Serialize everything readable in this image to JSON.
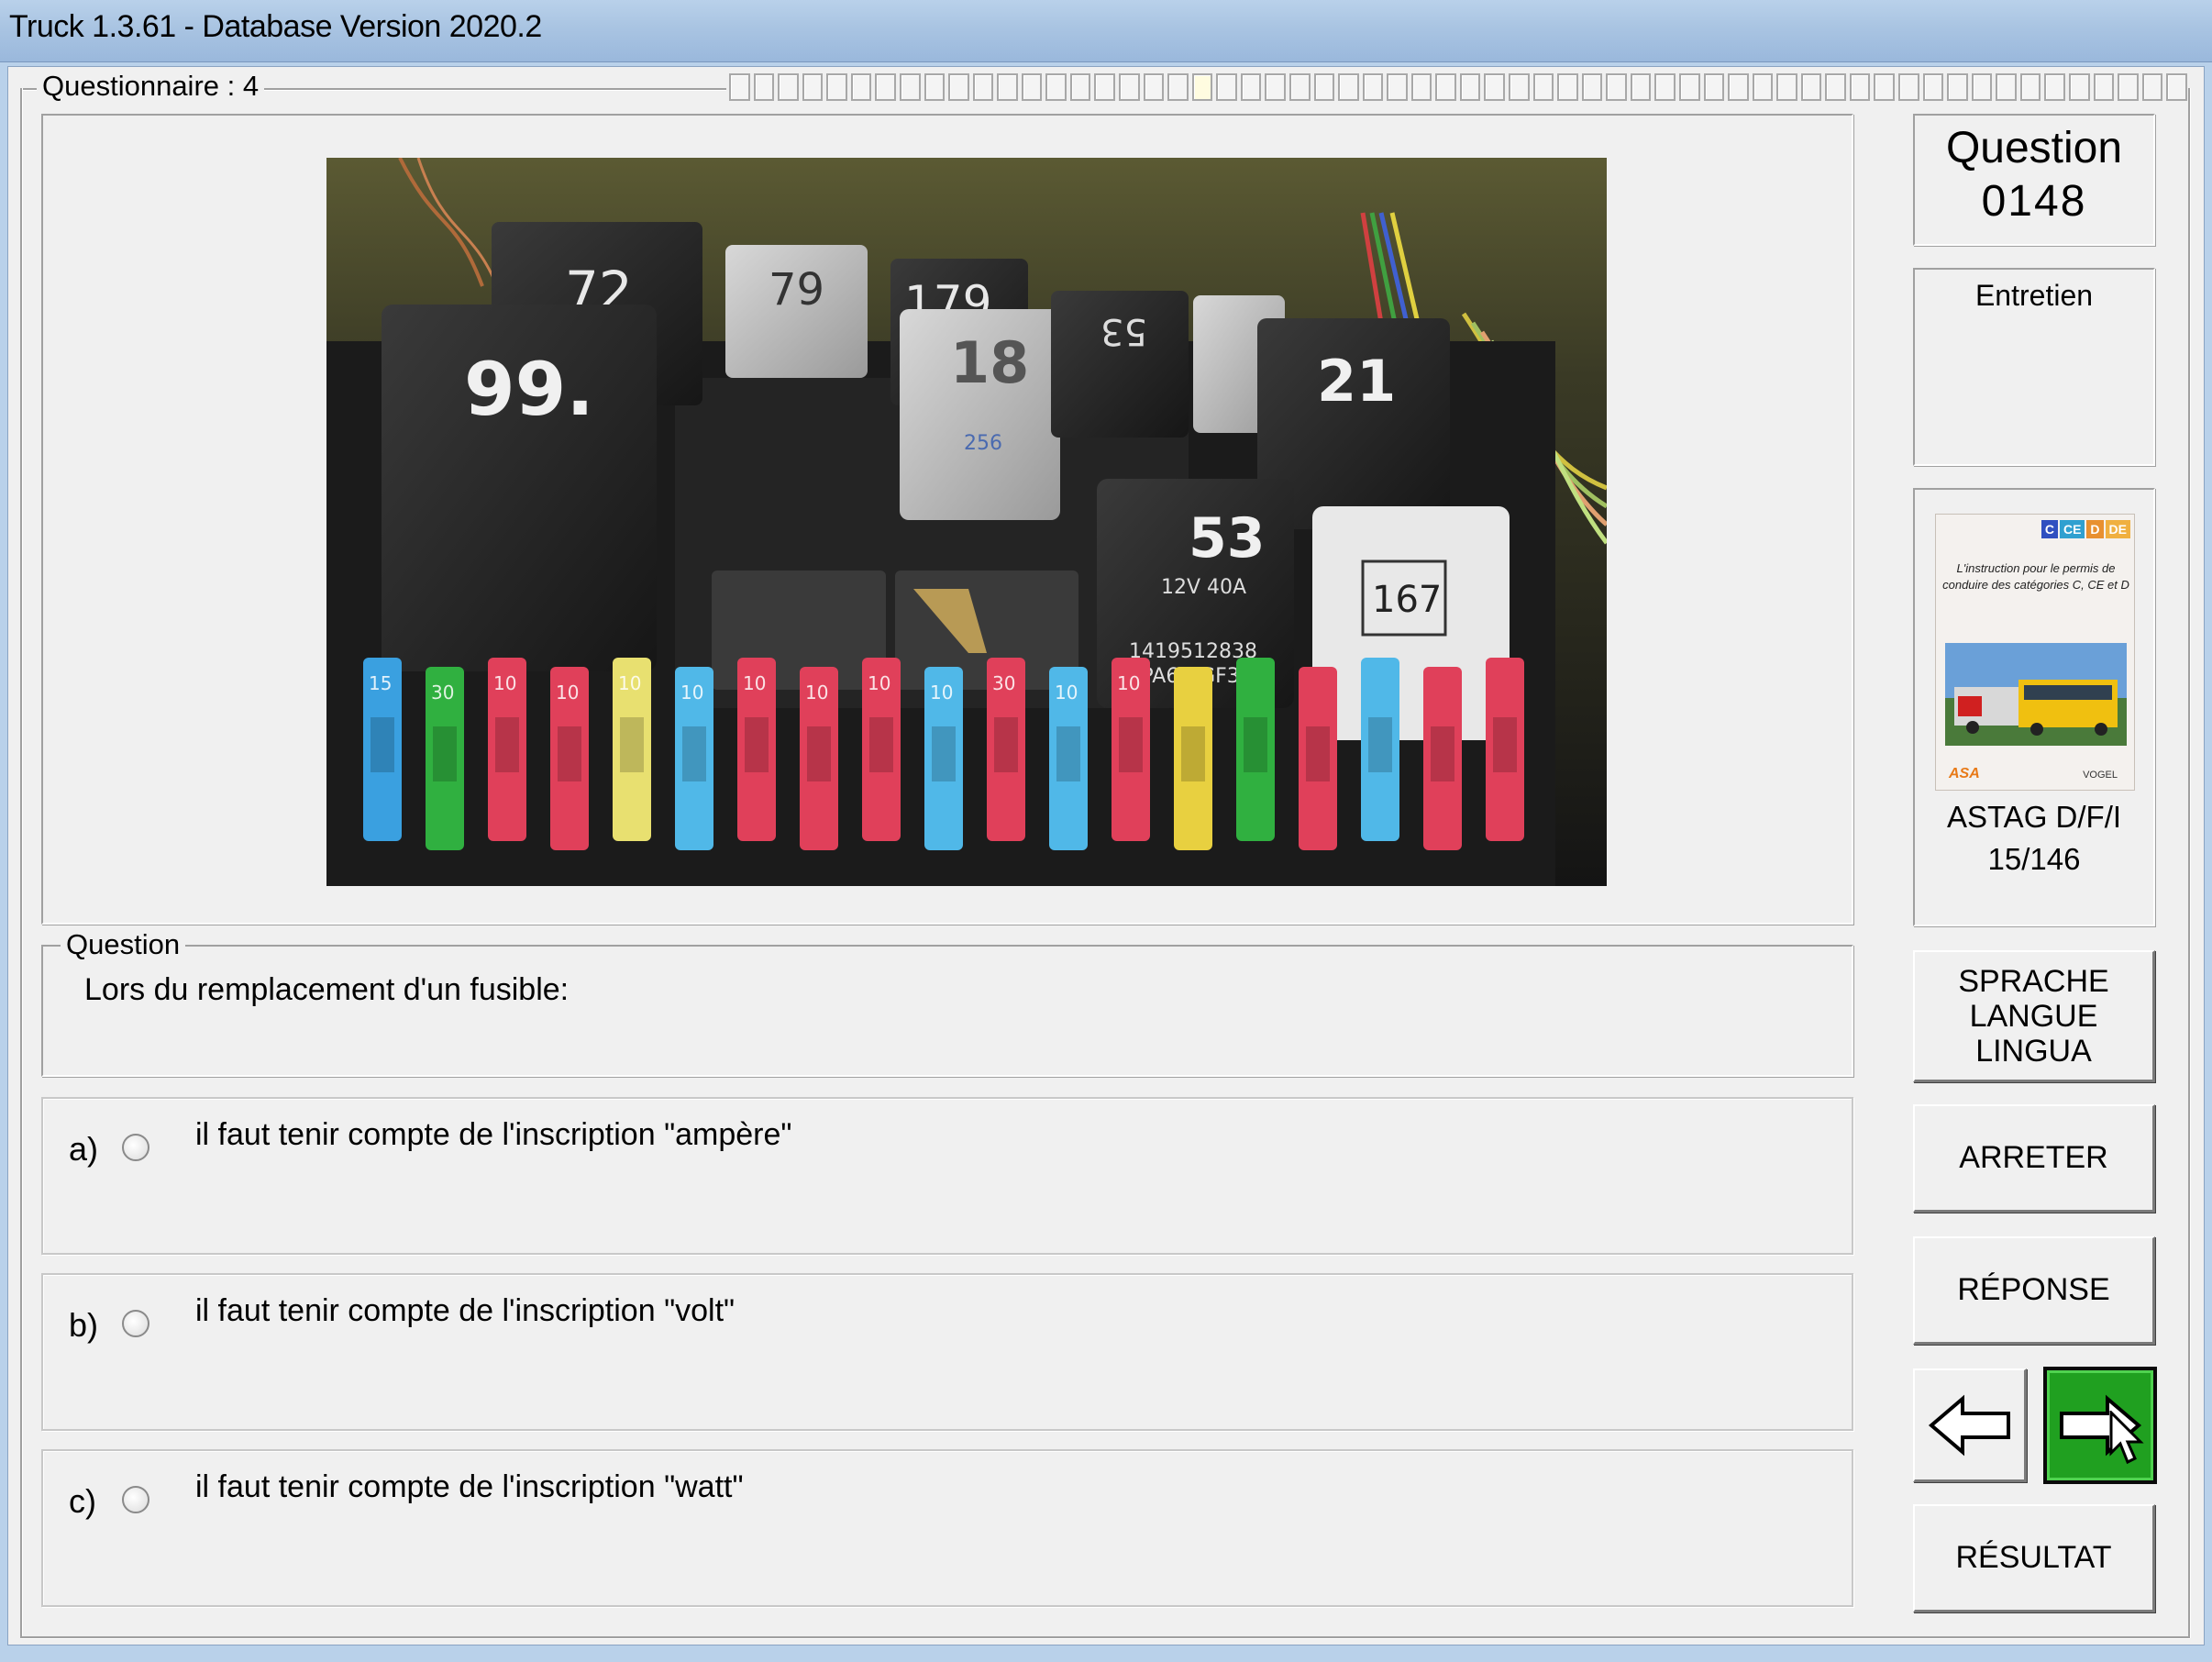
{
  "window": {
    "title": "Truck 1.3.61 - Database Version 2020.2"
  },
  "questionnaire": {
    "label": "Questionnaire : 4",
    "progress": {
      "total_segments": 60,
      "current_segment": 19
    }
  },
  "photo": {
    "relays": [
      "72",
      "79",
      "179",
      "53",
      "99.",
      "18",
      "256",
      "21",
      "53",
      "12V 40A",
      "1419512838",
      ">PA66-GF30<",
      "167"
    ],
    "fuse_labels": [
      "15",
      "30",
      "10",
      "10",
      "10",
      "10",
      "10",
      "10",
      "10",
      "10",
      "30",
      "10",
      "10"
    ]
  },
  "question": {
    "legend": "Question",
    "text": "Lors du remplacement d'un fusible:"
  },
  "answers": [
    {
      "letter": "a)",
      "text": "il faut tenir compte de l'inscription \"ampère\""
    },
    {
      "letter": "b)",
      "text": "il faut tenir compte de l'inscription \"volt\""
    },
    {
      "letter": "c)",
      "text": "il faut tenir compte de l'inscription \"watt\""
    }
  ],
  "sidebar": {
    "question_label": "Question",
    "question_number": "0148",
    "category": "Entretien",
    "book": {
      "badges": [
        "C",
        "CE",
        "D",
        "DE"
      ],
      "cover_text": "L'instruction pour le permis de conduire des catégories C, CE et D",
      "logo_left": "ASA",
      "logo_right": "VOGEL",
      "title": "ASTAG D/F/I",
      "page": "15/146"
    },
    "buttons": {
      "language_line1": "SPRACHE",
      "language_line2": "LANGUE",
      "language_line3": "LINGUA",
      "stop": "ARRETER",
      "answer": "RÉPONSE",
      "result": "RÉSULTAT"
    }
  },
  "colors": {
    "next_button": "#20a020",
    "titlebar": "#a9c4e2"
  }
}
